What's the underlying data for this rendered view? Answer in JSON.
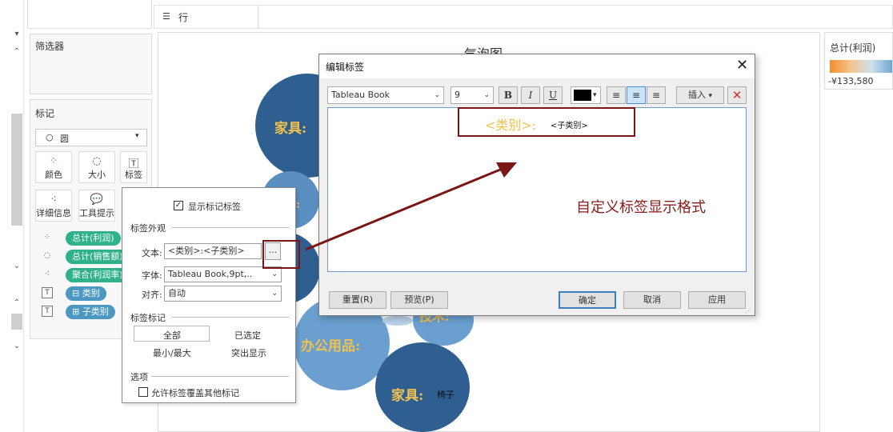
{
  "rows_shelf": {
    "icon": "rows-icon",
    "label": "行"
  },
  "filters": {
    "title": "筛选器"
  },
  "marks": {
    "title": "标记",
    "mark_type": "圆",
    "buttons": {
      "color": "颜色",
      "size": "大小",
      "label": "标签",
      "detail": "详细信息",
      "tooltip": "工具提示"
    },
    "pills": [
      {
        "text": "总计(利润)",
        "icon": "color-dots-icon"
      },
      {
        "text": "总计(销售额)",
        "icon": "size-icon"
      },
      {
        "text": "聚合(利润率)",
        "icon": "detail-dots-icon"
      },
      {
        "text": "⊟ 类别",
        "icon": "label-T-icon"
      },
      {
        "text": "⊞ 子类别",
        "icon": "label-T-icon"
      }
    ]
  },
  "chart": {
    "title": "气泡图",
    "bubble_labels": {
      "furniture_big": "家具:",
      "office": "办公用品:",
      "tech": "技术:",
      "furniture_small": "家具:",
      "chair": "椅子",
      "small": ":"
    }
  },
  "legend": {
    "title": "总计(利润)",
    "min_label": "-¥133,580",
    "colors": [
      "#f28e2b",
      "#6fa8d2"
    ]
  },
  "label_popup": {
    "show_labels": "显示标记标签",
    "appearance_header": "标签外观",
    "text_label": "文本:",
    "text_value": "<类别>:<子类别>",
    "more_button": "...",
    "font_label": "字体:",
    "font_value": "Tableau Book,9pt,..",
    "align_label": "对齐:",
    "align_value": "自动",
    "marks_header": "标签标记",
    "opt_all": "全部",
    "opt_selected": "已选定",
    "opt_minmax": "最小/最大",
    "opt_highlight": "突出显示",
    "options_header": "选项",
    "allow_overlap": "允许标签覆盖其他标记"
  },
  "edit_dialog": {
    "title": "编辑标签",
    "font_family": "Tableau Book",
    "font_size": "9",
    "bold": "B",
    "italic": "I",
    "underline": "U",
    "insert": "插入",
    "editor_field": "<类别>:",
    "editor_text": "<子类别>",
    "reset": "重置(R)",
    "preview": "预览(P)",
    "ok": "确定",
    "cancel": "取消",
    "apply": "应用"
  },
  "annotation": {
    "text": "自定义标签显示格式"
  }
}
